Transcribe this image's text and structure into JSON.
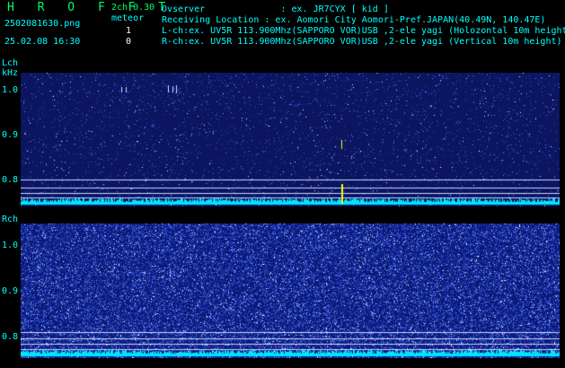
{
  "header": {
    "title_letters": "H R O F F T",
    "mode": "2ch 0.30",
    "meteor_label": "meteor",
    "count_1": "1",
    "count_2": "0",
    "filename": "2502081630.png",
    "datetime": "25.02.08 16:30"
  },
  "info": {
    "observer": "Ovserver              : ex. JR7CYX [ kid ]",
    "location": "Receiving Location : ex. Aomori City Aomori-Pref.JAPAN(40.49N, 140.47E)",
    "lch": "L-ch:ex. UV5R 113.900Mhz(SAPPORO VOR)USB ,2-ele yagi (Holozontal 10m height)",
    "rch": "R-ch:ex. UV5R 113.900Mhz(SAPPORO VOR)USB ,2-ele yagi (Vertical 10m height)"
  },
  "lch": {
    "label": "Lch",
    "unit": "kHz",
    "y_labels": [
      "1.0",
      "0.9",
      "0.8"
    ],
    "x_labels": [
      "1631",
      "1632",
      "1633",
      "1634",
      "1635",
      "1636",
      "1637",
      "1638",
      "1639",
      "1640"
    ]
  },
  "rch": {
    "label": "Rch",
    "y_labels": [
      "1.0",
      "0.9",
      "0.8"
    ]
  },
  "colors": {
    "background": "#000000",
    "accent_cyan": "#00ffff",
    "title_green": "#00ff66",
    "text_white": "#ffffff",
    "marker_yellow": "#ffff00",
    "lch_panel": "#0b1560",
    "rch_panel": "#0b1a7a"
  }
}
